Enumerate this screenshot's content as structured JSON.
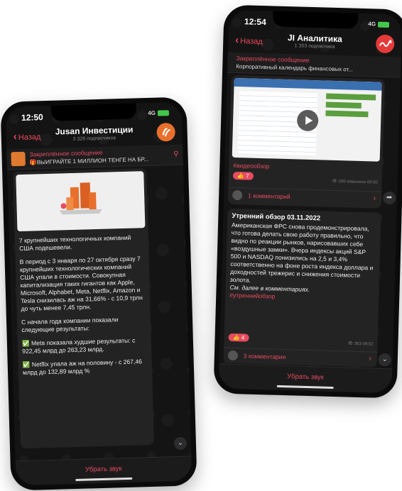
{
  "left": {
    "status": {
      "time": "12:50",
      "network": "4G"
    },
    "back_label": "Назад",
    "channel_title": "Jusan Инвестиции",
    "subscribers": "3 328 подписчиков",
    "pinned": {
      "label": "Закреплённое сообщение",
      "text": "🎁ВЫИГРАЙТЕ 1 МИЛЛИОН ТЕНГЕ НА БР..."
    },
    "paragraphs": [
      "7 крупнейших технологичных компаний США подешевели.",
      "В период с 3 января по 27 октября сразу 7 крупнейших технологических компаний США упали в стоимости. Совокупная капитализация таких гигантов как Apple, Microsoft, Alphabet, Meta, Netflix, Amazon и Tesla снизилась аж на 31,66% - с 10,9 трлн до чуть менее 7,45 трлн.",
      "С начала года компании показали следующие результаты:",
      "✅ Meta показала худшие результаты: с 922,45 млрд до 263,23 млрд.",
      "✅ Netflix упала аж на половину - с 267,46 млрд до 132,89 млрд %"
    ],
    "footer": "Убрать звук"
  },
  "right": {
    "status": {
      "time": "12:54",
      "network": "4G"
    },
    "back_label": "Назад",
    "channel_title": "JI Аналитика",
    "subscribers": "1 353 подписчика",
    "pinned": {
      "label": "Закреплённое сообщение",
      "text": "Корпоративный календарь финансовых от..."
    },
    "post1": {
      "hashtag": "#видеообзор",
      "reaction": "👍 7",
      "views": "👁 290 изменено 09:50",
      "comments": "1 комментарий"
    },
    "post2": {
      "title": "Утренний обзор 03.11.2022",
      "body": "Американская ФРС снова продемонстрировала, что готова делать свою работу правильно, что видно по реакции рынков, нарисовавших себе «воздушные замки». Вчера индексы акций S&P 500 и NASDAQ понизились на 2,5 и 3,4% соответственно на фоне роста индекса доллара и доходностей трежерис и снижения стоимости золота.",
      "more": "См. далее в комментариях.",
      "hashtag": "#утреннийобзор",
      "reaction": "👍 4",
      "views": "👁 363 09:52",
      "comments": "3 комментария"
    },
    "footer": "Убрать звук"
  },
  "colors": {
    "accent": "#e64c5f",
    "background": "#151414",
    "bubble": "#242323"
  }
}
